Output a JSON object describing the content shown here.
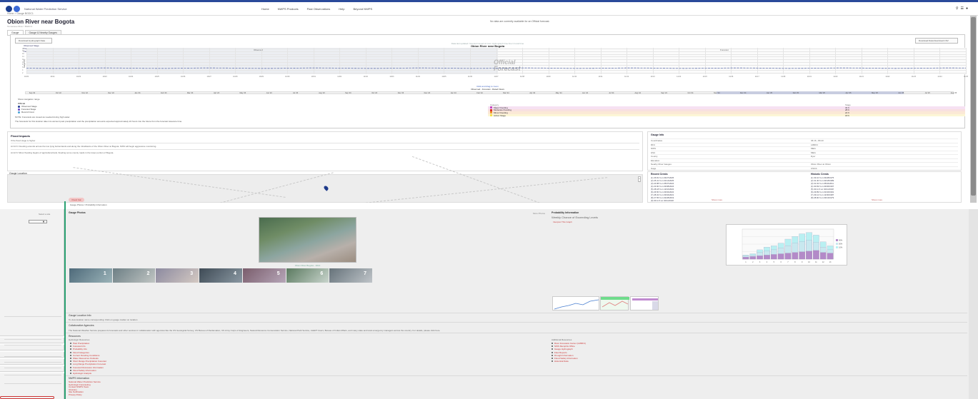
{
  "header": {
    "agency": "National Water Prediction Service",
    "nav": [
      "Home",
      "NWPS Products",
      "Past Observations",
      "Help",
      "Beyond NWPS"
    ],
    "utility_icons": [
      "search-icon",
      "menu-icon",
      "user-icon"
    ],
    "breadcrumb": "Home > Gauge BGDC1",
    "title": "Obion River near Bogota",
    "subtitle": "Tennessee River / BGDC1",
    "notice": "No data are currently available for an Official forecast.",
    "tabs": [
      "Gauge",
      "Gauge & Nearby Gauges"
    ]
  },
  "hydrograph": {
    "btn_left": "Download Hydrograph Data",
    "btn_right": "Download Data Download CSV",
    "mini_legend": [
      "Observed Stage",
      "Forecast Stage",
      "Flood Stage"
    ],
    "top_note": "Data last updated: forecast issued at noon Hydrograph time line in local time",
    "title": "Obion River near Bogota",
    "subtitle": "Observed / Official Forecast",
    "obs_label": "Observed",
    "fcst_label": "Forecast",
    "official_line1": "Official",
    "official_line2": "Forecast",
    "y_label": "Stage (ft)",
    "y_ticks": [
      "20",
      "18",
      "16",
      "14",
      "12",
      "10",
      "8",
      "6",
      "4",
      "2"
    ],
    "x_ticks": [
      "10/20",
      "10/21",
      "10/22",
      "10/23",
      "10/24",
      "10/25",
      "10/26",
      "10/27",
      "10/28",
      "10/29",
      "10/30",
      "10/31",
      "11/01",
      "11/02",
      "11/03",
      "11/04",
      "11/05",
      "11/06",
      "11/07",
      "11/08",
      "11/09",
      "11/10",
      "11/11",
      "11/12",
      "11/13",
      "11/14",
      "11/15",
      "11/16",
      "11/17",
      "11/18",
      "11/19",
      "11/20",
      "11/21",
      "11/22",
      "11/23",
      "11/24",
      "11/25"
    ],
    "nav_ticks": [
      "Sep '22",
      "Oct '22",
      "Nov '22",
      "Dec '22",
      "Jan '23",
      "Feb '23",
      "Mar '23",
      "Apr '23",
      "May '23",
      "Jun '23",
      "Jul '23",
      "Aug '23",
      "Sep '23",
      "Oct '23",
      "Nov '23",
      "Dec '23",
      "Jan '24",
      "Feb '24",
      "Mar '24",
      "Apr '24",
      "May '24",
      "Jun '24",
      "Jul '24",
      "Aug '24",
      "Sep '24",
      "Oct '24",
      "Nov '24",
      "Dec '24",
      "Jan '25",
      "Feb '25",
      "Mar '25",
      "Apr '25",
      "May '25",
      "Jun '25",
      "Jul '25",
      "Aug '25"
    ],
    "center_caption_1": "Click and drag to zoom",
    "center_caption_2": "Observed - Forecast - Rated Flows",
    "range_label": "Show navigation range",
    "legend_title": "Official",
    "legend": [
      {
        "label": "Observed Stage",
        "color": "#1f3a93"
      },
      {
        "label": "Forecast Stage",
        "color": "#6b49c8"
      },
      {
        "label": "Record Crest",
        "color": "#4aa3d6"
      }
    ],
    "disclaimer_1": "NOTE: Forecasts are issued as needed during high water.",
    "disclaimer_2": "The forecasts for this location take into account past precipitation and the precipitation amounts expected approximately 24 hours into the future from the forecast issuance time.",
    "flood_table": {
      "headers": [
        "Category",
        "Stage"
      ],
      "rows": [
        {
          "label": "Major Flooding",
          "value": "34 ft",
          "color": "#c44cc0"
        },
        {
          "label": "Moderate Flooding",
          "value": "28 ft",
          "color": "#d9342b"
        },
        {
          "label": "Minor Flooding",
          "value": "22 ft",
          "color": "#f0952c"
        },
        {
          "label": "Action Stage",
          "value": "18 ft",
          "color": "#f5e14a"
        }
      ]
    }
  },
  "flood_impacts": {
    "title": "Flood Impacts",
    "line1": "If the flood stage is higher",
    "line2": "At 34 ft: Flooding extends across the low lying bottomlands and along the inhabitants of the Obion River at Bogota. NWS will begin aggressive monitoring.",
    "line3": "At 22 ft: Minor flooding begins of agricultural land, flooding some county roads in the lower portion of Bogota."
  },
  "gauge_info": {
    "title": "Gauge Info",
    "rows": [
      {
        "k": "Coordinates",
        "v": "36.16, -89.43"
      },
      {
        "k": "RFC",
        "v": "LMRFC"
      },
      {
        "k": "NWS",
        "v": "MEG"
      },
      {
        "k": "HSA",
        "v": "MEG"
      },
      {
        "k": "County",
        "v": "Dyer"
      },
      {
        "k": "Elevation",
        "v": ""
      },
      {
        "k": "Nearby River Gauges",
        "v": "Obion River at Obion"
      },
      {
        "k": "Gage",
        "v": "USGS"
      }
    ]
  },
  "map": {
    "label": "Gauge Location"
  },
  "crests": {
    "recent_title": "Recent Crests",
    "historic_title": "Historic Crests",
    "recent": [
      "(1) 26.81 ft on 03/27/2025",
      "(2) 25.41 ft on 01/14/2025",
      "(3) 24.88 ft on 05/07/2024",
      "(4) 23.90 ft on 03/08/2024",
      "(5) 28.18 ft on 12/10/2022",
      "(6) 26.50 ft on 03/02/2022",
      "(7) 28.32 ft on 03/04/2021",
      "(8) 27.55 ft on 02/28/2019",
      "(9) 30.11 ft on 04/11/2018"
    ],
    "historic": [
      "(1) 33.10 ft on 03/28/1975",
      "(2) 31.40 ft on 02/18/1989",
      "(3) 31.02 ft on 05/04/2011",
      "(4) 30.69 ft on 03/06/1997",
      "(5) 30.11 ft on 04/11/2018",
      "(6) 29.89 ft on 01/04/1991",
      "(7) 29.12 ft on 12/30/1987",
      "(8) 28.90 ft on 03/13/1979"
    ],
    "more_recent": "Show more",
    "more_historic": "Show more"
  },
  "lower": {
    "sidebar_label": "Select a site",
    "pill": "Flood Cat",
    "tab_note": "Gauge Photos / Probability Information",
    "photos_title": "Gauge Photos",
    "photo_caption": "Obion River Bogota - 2014",
    "more_photos": "More Photos",
    "thumbs": [
      "1",
      "2",
      "3",
      "4",
      "5",
      "6",
      "7"
    ],
    "prob_title": "Probability Information",
    "prob_subtitle": "Weekly Chance of Exceeding Levels",
    "prob_link": "Interpret This Graph",
    "probchart": {
      "categories": [
        "1",
        "2",
        "3",
        "4",
        "5",
        "6",
        "7",
        "8",
        "9",
        "10",
        "11",
        "12",
        "13"
      ],
      "series": [
        {
          "name": "90%",
          "color": "#b38ac8",
          "values": [
            3,
            4,
            5,
            6,
            7,
            8,
            9,
            10,
            11,
            12,
            13,
            10,
            9
          ]
        },
        {
          "name": "50%",
          "color": "#c8e8ef",
          "values": [
            5,
            6,
            10,
            12,
            14,
            17,
            20,
            24,
            26,
            28,
            25,
            18,
            14
          ]
        },
        {
          "name": "10%",
          "color": "#b9f0f2",
          "values": [
            6,
            8,
            14,
            18,
            20,
            24,
            30,
            34,
            38,
            40,
            36,
            26,
            20
          ]
        }
      ],
      "ylim": [
        0,
        45
      ]
    },
    "gauge_info_title": "Gauge Location Info",
    "gauge_info_text": "To view location name corresponding: Click on gauge marker on location",
    "collab_title": "Collaborative Agencies",
    "collab_text": "The National Weather Service prepares its forecasts and other services in collaboration with agencies like the US Geological Survey, US Bureau of Reclamation, US Army Corps of Engineers, Natural Resource Conservation Service, National Park Service, ALERT Users, Bureau of Indian Affairs, and many state and local emergency managers across the country. For details, please click here.",
    "resources_title": "Resources",
    "hydro_title": "Hydrologic Resources",
    "links_left": [
      "Past Precipitation",
      "Forecast Info",
      "Probability Info",
      "Flood Categories",
      "Current Flooding Conditions",
      "Water Resources Outlooks",
      "Short Range Precipitation Forecast",
      "Long Range Precipitation Forecast",
      "Forecast Discussion Information",
      "Flood Safety Information",
      "Hydrologic Analysis"
    ],
    "links_right_title": "Additional Resources",
    "links_right": [
      "River Forecasts Center (LMRFC)",
      "NWS Memphis Office",
      "Gauge Hydrograph",
      "Flow Reports",
      "Drought Information",
      "Flood Safety Information",
      "Historical Data"
    ],
    "nwps_title": "NWPS Information",
    "nwps_lines": [
      "National Water Prediction Service",
      "Hydrologic Forecasting",
      "Contact NWPS Team",
      "Glossary",
      "Site Notification",
      "Privacy Policy"
    ]
  }
}
